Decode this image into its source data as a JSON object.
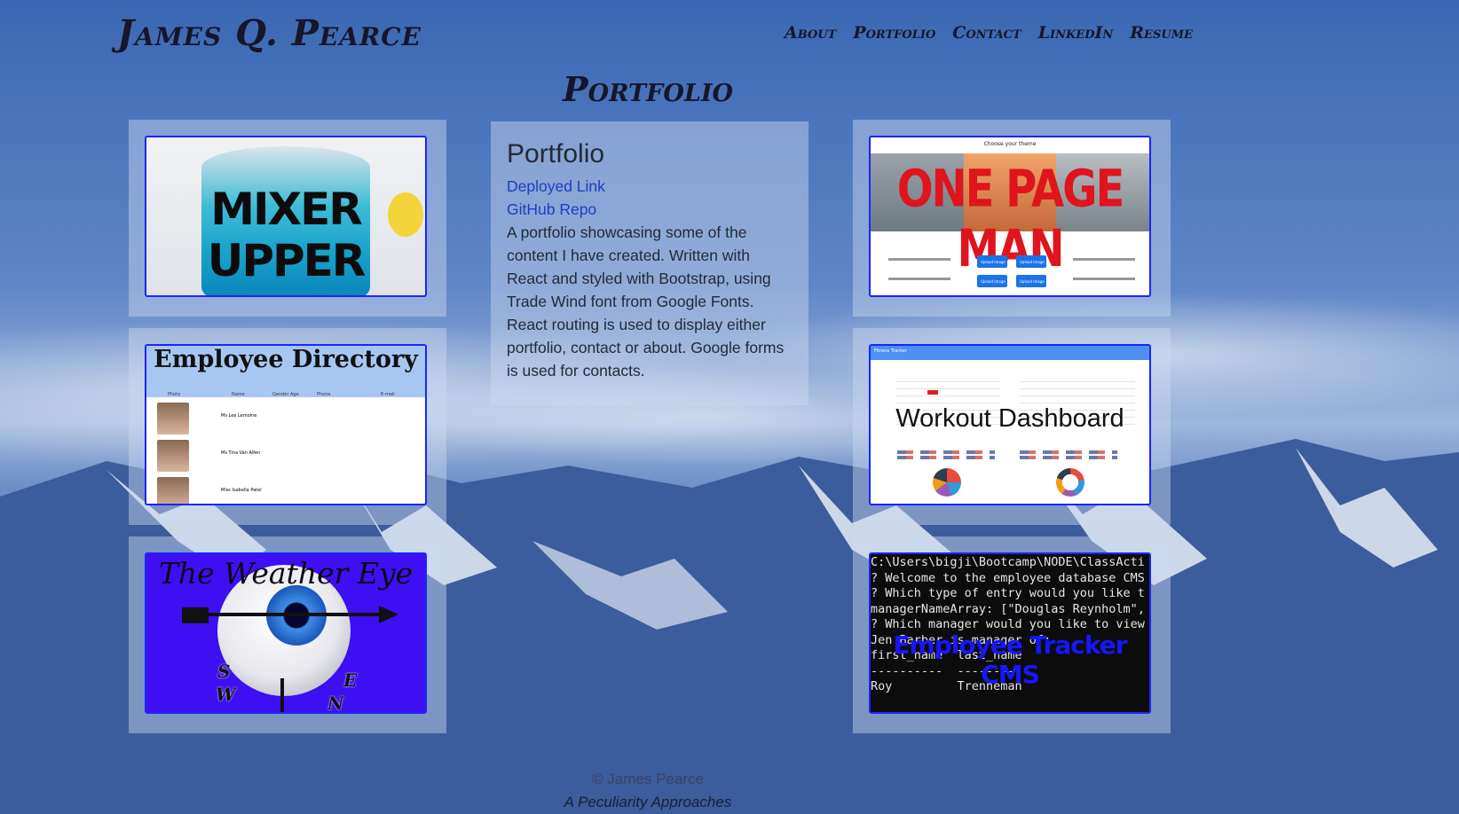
{
  "header": {
    "title": "James Q. Pearce",
    "nav": [
      "About",
      "Portfolio",
      "Contact",
      "LinkedIn",
      "Resume"
    ]
  },
  "page_heading": "Portfolio",
  "info_panel": {
    "title": "Portfolio",
    "deployed_link": "Deployed Link",
    "github_link": "GitHub Repo",
    "description": "A portfolio showcasing some of the content I have created. Written with React and styled with Bootstrap, using Trade Wind font from Google Fonts. React routing is used to display either portfolio, contact or about. Google forms is used for contacts."
  },
  "projects": {
    "mixer_upper": {
      "label": "MIXER UPPER"
    },
    "employee_directory": {
      "label": "Employee Directory",
      "columns": [
        "Photo",
        "Name",
        "Gender",
        "Age",
        "Phone",
        "E-mail"
      ],
      "rows": [
        "Ms Lea Lemoine",
        "Ms Tina Van Alfen",
        "Miss Isabella Patel"
      ]
    },
    "weather_eye": {
      "label": "The Weather Eye",
      "directions": [
        "S",
        "W",
        "E",
        "N"
      ]
    },
    "one_page_man": {
      "label": "ONE PAGE MAN",
      "choose_text": "Choose your theme",
      "buttons": [
        "Upload Image",
        "Upload Image",
        "Upload Image",
        "Upload Image"
      ]
    },
    "workout_dashboard": {
      "label": "Workout Dashboard",
      "bar_title": "Fitness Tracker"
    },
    "employee_tracker": {
      "label": "Employee Tracker CMS",
      "cli_lines": [
        "C:\\Users\\bigji\\Bootcamp\\NODE\\ClassActi",
        "? Welcome to the employee database CMS",
        "? Which type of entry would you like t",
        "managerNameArray: [\"Douglas Reynholm\",",
        "? Which manager would you like to view",
        "Jen Barber is manager of:",
        "first_name  last_name",
        "----------  ---------",
        "Roy         Trenneman"
      ]
    }
  },
  "footer": {
    "copyright": "© James Pearce",
    "tagline": "A Peculiarity Approaches"
  },
  "colors": {
    "accent_border": "#1c24ff",
    "link": "#1c3fbf",
    "text_dark": "#16162a",
    "weather_bg": "#3d0ff2",
    "one_page_man_red": "#e0141c"
  }
}
